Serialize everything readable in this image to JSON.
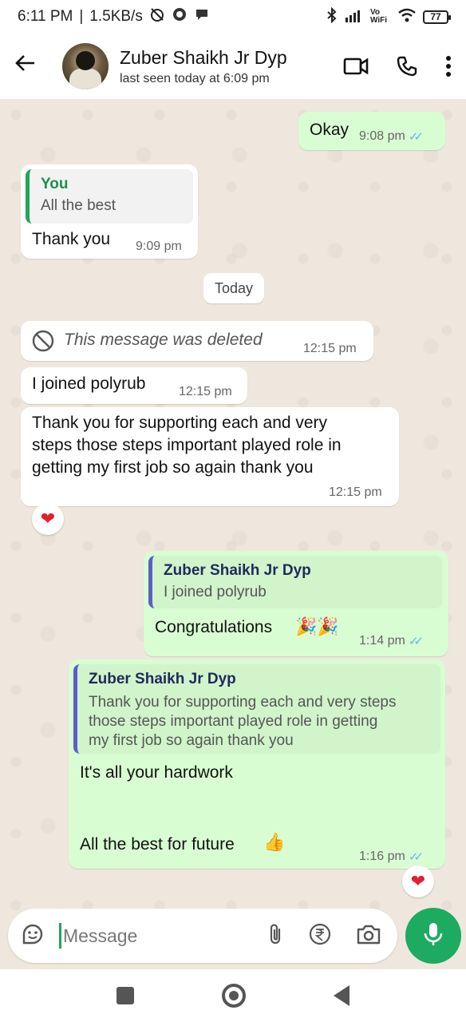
{
  "status_bar": {
    "time": "6:11 PM",
    "network_speed": "1.5KB/s",
    "volte": "Vo WiFi",
    "battery": "77"
  },
  "header": {
    "contact_name": "Zuber Shaikh Jr Dyp",
    "last_seen": "last seen today at 6:09 pm"
  },
  "messages": [
    {
      "id": "m1",
      "direction": "out",
      "text": "Okay",
      "time": "9:08 pm"
    },
    {
      "id": "m2",
      "direction": "in",
      "quote_name": "You",
      "quote_text": "All the best",
      "text": "Thank you",
      "time": "9:09 pm"
    },
    {
      "id": "m3",
      "direction": "in",
      "text": "This message was deleted",
      "time": "12:15 pm",
      "deleted": true
    },
    {
      "id": "m4",
      "direction": "in",
      "text": "I joined polyrub",
      "time": "12:15 pm"
    },
    {
      "id": "m5",
      "direction": "in",
      "text_lines": [
        "Thank you for supporting each and very",
        "steps those steps important played role in",
        "getting my first job so again thank you"
      ],
      "time": "12:15 pm",
      "reaction": "❤"
    },
    {
      "id": "m6",
      "direction": "out",
      "quote_name": "Zuber Shaikh Jr Dyp",
      "quote_text": "I joined polyrub",
      "text": "Congratulations",
      "emoji": "🎉🎉",
      "time": "1:14 pm"
    },
    {
      "id": "m7",
      "direction": "out",
      "quote_name": "Zuber Shaikh Jr Dyp",
      "quote_lines": [
        "Thank you for supporting each and very steps",
        "those steps important played role in getting",
        "my first job so again thank you"
      ],
      "text": "It's all your hardwork",
      "text2": "All the best for future",
      "emoji": "👍",
      "time": "1:16 pm",
      "reaction": "❤"
    }
  ],
  "date_divider": "Today",
  "input": {
    "placeholder": "Message"
  },
  "colors": {
    "outgoing_bubble": "#d9fdd3",
    "incoming_bubble": "#ffffff",
    "chat_background": "#efe7dd",
    "accent_green": "#1daa61",
    "read_tick": "#53bdeb"
  },
  "icons": {
    "header": [
      "back-arrow-icon",
      "video-call-icon",
      "voice-call-icon",
      "more-vert-icon"
    ],
    "input": [
      "sticker-icon",
      "attach-icon",
      "rupee-payment-icon",
      "camera-icon",
      "mic-icon"
    ]
  }
}
